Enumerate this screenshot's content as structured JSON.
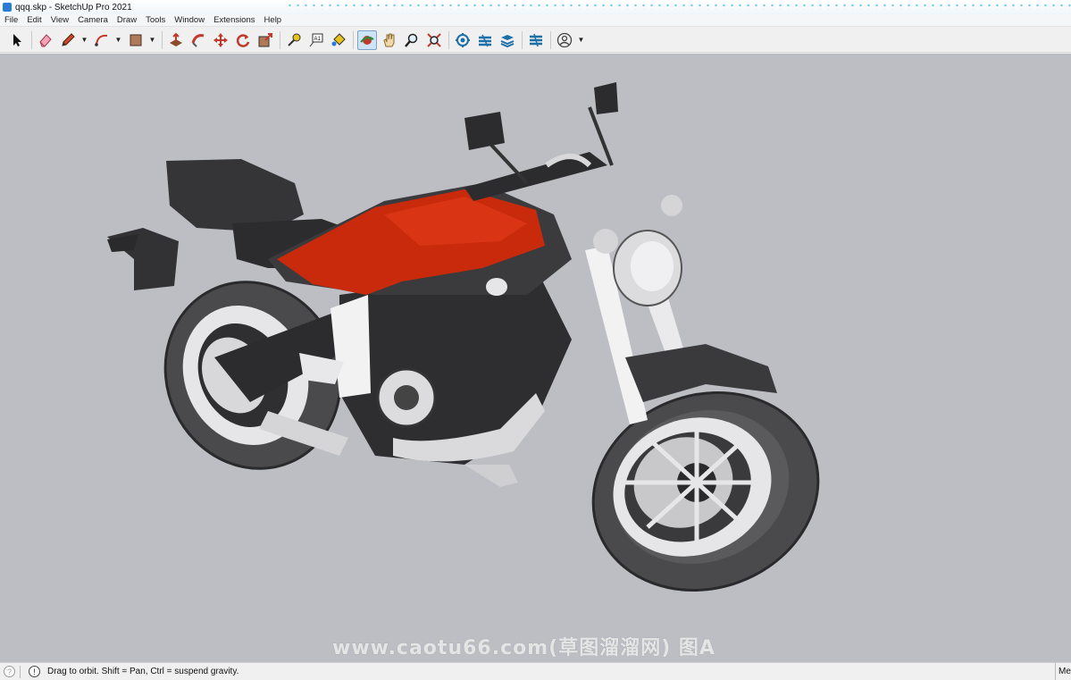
{
  "window": {
    "title": "qqq.skp - SketchUp Pro 2021"
  },
  "menu": [
    "File",
    "Edit",
    "View",
    "Camera",
    "Draw",
    "Tools",
    "Window",
    "Extensions",
    "Help"
  ],
  "toolbar": {
    "tools": [
      {
        "name": "select-tool",
        "icon": "arrow-cursor-icon"
      },
      {
        "name": "eraser-tool",
        "icon": "eraser-icon"
      },
      {
        "name": "line-tool",
        "icon": "pencil-icon"
      },
      {
        "name": "arc-tool",
        "icon": "arc-icon"
      },
      {
        "name": "shape-tool",
        "icon": "rectangle-icon"
      },
      {
        "name": "push-pull-tool",
        "icon": "push-pull-icon"
      },
      {
        "name": "follow-me-tool",
        "icon": "follow-me-icon"
      },
      {
        "name": "move-tool",
        "icon": "move-icon"
      },
      {
        "name": "rotate-tool",
        "icon": "rotate-icon"
      },
      {
        "name": "scale-tool",
        "icon": "scale-icon"
      },
      {
        "name": "tape-measure-tool",
        "icon": "tape-measure-icon"
      },
      {
        "name": "text-tool",
        "icon": "text-icon"
      },
      {
        "name": "paint-bucket-tool",
        "icon": "paint-bucket-icon"
      },
      {
        "name": "orbit-tool",
        "icon": "orbit-icon"
      },
      {
        "name": "pan-tool",
        "icon": "hand-icon"
      },
      {
        "name": "zoom-tool",
        "icon": "magnifier-icon"
      },
      {
        "name": "zoom-extents-tool",
        "icon": "zoom-extents-icon"
      },
      {
        "name": "warehouse-tool",
        "icon": "warehouse-icon"
      },
      {
        "name": "extension-warehouse-tool",
        "icon": "extension-warehouse-icon"
      },
      {
        "name": "layers-tool",
        "icon": "layers-icon"
      },
      {
        "name": "trimble-connect-tool",
        "icon": "trimble-icon"
      },
      {
        "name": "account-tool",
        "icon": "user-icon"
      }
    ],
    "active_tool": "orbit-tool"
  },
  "viewport": {
    "background": "#bcbec4",
    "watermark": "www.caotu66.com(草图溜溜网) 图A",
    "model": {
      "body_color": "#3a3a3c",
      "tank_color": "#c92a0c",
      "accent_color": "#f2f2f2"
    }
  },
  "status": {
    "message": "Drag to orbit. Shift = Pan, Ctrl = suspend gravity.",
    "measurements_label": "Me"
  }
}
